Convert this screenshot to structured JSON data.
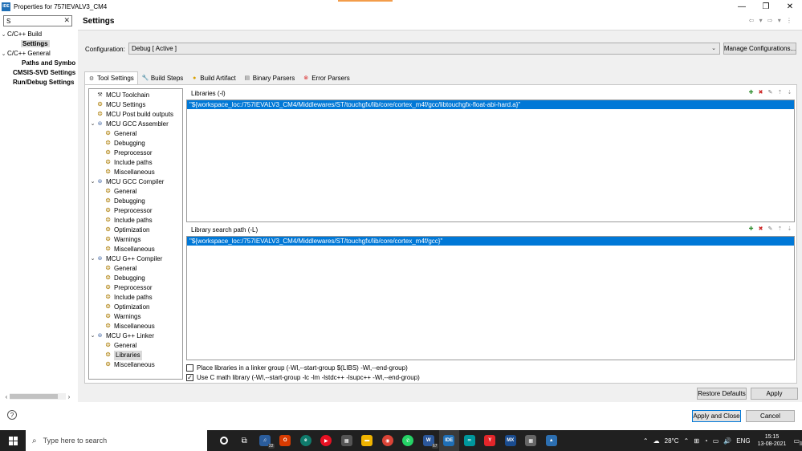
{
  "window": {
    "title": "Properties for 757IEVALV3_CM4",
    "app_icon": "IDE"
  },
  "left": {
    "filter_value": "S",
    "tree": [
      {
        "label": "C/C++ Build",
        "expanded": true,
        "indent": 0,
        "bold": false
      },
      {
        "label": "Settings",
        "indent": 1,
        "selected": true
      },
      {
        "label": "C/C++ General",
        "expanded": true,
        "indent": 0,
        "bold": false
      },
      {
        "label": "Paths and Symbo",
        "indent": 1,
        "bold": true
      },
      {
        "label": "CMSIS-SVD Settings",
        "indent": 0,
        "bold": true
      },
      {
        "label": "Run/Debug Settings",
        "indent": 0,
        "bold": true
      }
    ]
  },
  "main": {
    "page_title": "Settings",
    "configuration_label": "Configuration:",
    "configuration_value": "Debug  [ Active ]",
    "manage_button": "Manage Configurations...",
    "tabs": [
      {
        "label": "Tool Settings",
        "icon": "tool-settings-icon"
      },
      {
        "label": "Build Steps",
        "icon": "build-steps-icon"
      },
      {
        "label": "Build Artifact",
        "icon": "build-artifact-icon"
      },
      {
        "label": "Binary Parsers",
        "icon": "binary-parsers-icon"
      },
      {
        "label": "Error Parsers",
        "icon": "error-parsers-icon"
      }
    ],
    "tool_tree": [
      {
        "label": "MCU Toolchain",
        "level": 0,
        "icon": "tool"
      },
      {
        "label": "MCU Settings",
        "level": 0,
        "icon": "gear"
      },
      {
        "label": "MCU Post build outputs",
        "level": 0,
        "icon": "gear"
      },
      {
        "label": "MCU GCC Assembler",
        "level": 0,
        "icon": "blue",
        "expander": true
      },
      {
        "label": "General",
        "level": 1,
        "icon": "gear"
      },
      {
        "label": "Debugging",
        "level": 1,
        "icon": "gear"
      },
      {
        "label": "Preprocessor",
        "level": 1,
        "icon": "gear"
      },
      {
        "label": "Include paths",
        "level": 1,
        "icon": "gear"
      },
      {
        "label": "Miscellaneous",
        "level": 1,
        "icon": "gear"
      },
      {
        "label": "MCU GCC Compiler",
        "level": 0,
        "icon": "blue",
        "expander": true
      },
      {
        "label": "General",
        "level": 1,
        "icon": "gear"
      },
      {
        "label": "Debugging",
        "level": 1,
        "icon": "gear"
      },
      {
        "label": "Preprocessor",
        "level": 1,
        "icon": "gear"
      },
      {
        "label": "Include paths",
        "level": 1,
        "icon": "gear"
      },
      {
        "label": "Optimization",
        "level": 1,
        "icon": "gear"
      },
      {
        "label": "Warnings",
        "level": 1,
        "icon": "gear"
      },
      {
        "label": "Miscellaneous",
        "level": 1,
        "icon": "gear"
      },
      {
        "label": "MCU G++ Compiler",
        "level": 0,
        "icon": "blue",
        "expander": true
      },
      {
        "label": "General",
        "level": 1,
        "icon": "gear"
      },
      {
        "label": "Debugging",
        "level": 1,
        "icon": "gear"
      },
      {
        "label": "Preprocessor",
        "level": 1,
        "icon": "gear"
      },
      {
        "label": "Include paths",
        "level": 1,
        "icon": "gear"
      },
      {
        "label": "Optimization",
        "level": 1,
        "icon": "gear"
      },
      {
        "label": "Warnings",
        "level": 1,
        "icon": "gear"
      },
      {
        "label": "Miscellaneous",
        "level": 1,
        "icon": "gear"
      },
      {
        "label": "MCU G++ Linker",
        "level": 0,
        "icon": "blue",
        "expander": true
      },
      {
        "label": "General",
        "level": 1,
        "icon": "gear"
      },
      {
        "label": "Libraries",
        "level": 1,
        "icon": "gear",
        "selected": true
      },
      {
        "label": "Miscellaneous",
        "level": 1,
        "icon": "gear"
      }
    ],
    "libraries": {
      "label": "Libraries (-l)",
      "items": [
        "\"${workspace_loc:/757IEVALV3_CM4/Middlewares/ST/touchgfx/lib/core/cortex_m4f/gcc/libtouchgfx-float-abi-hard.a}\""
      ]
    },
    "library_search": {
      "label": "Library search path (-L)",
      "items": [
        "\"${workspace_loc:/757IEVALV3_CM4/Middlewares/ST/touchgfx/lib/core/cortex_m4f/gcc}\""
      ]
    },
    "checkboxes": [
      {
        "label": "Place libraries in a linker group (-Wl,--start-group $(LIBS) -Wl,--end-group)",
        "checked": false
      },
      {
        "label": "Use C math library (-Wl,--start-group -lc -lm -lstdc++ -lsupc++ -Wl,--end-group)",
        "checked": true
      }
    ],
    "restore_defaults": "Restore Defaults",
    "apply": "Apply"
  },
  "footer": {
    "apply_close": "Apply and Close",
    "cancel": "Cancel"
  },
  "taskbar": {
    "search_placeholder": "Type here to search",
    "badges": {
      "music": "22",
      "word": "67"
    },
    "weather": "28°C",
    "language": "ENG",
    "time": "15:15",
    "date": "13-08-2021",
    "notifications": "19"
  }
}
